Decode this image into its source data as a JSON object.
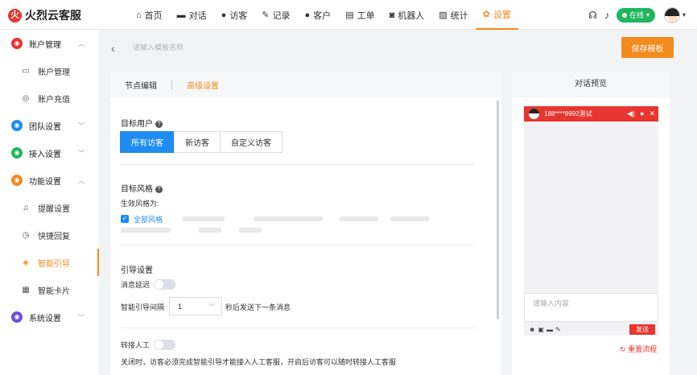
{
  "brand": {
    "logo_glyph": "火",
    "name": "火烈云客服",
    "color": "#e8352f"
  },
  "nav": [
    {
      "label": "首页",
      "icon": "home-icon",
      "glyph": "⌂"
    },
    {
      "label": "对话",
      "icon": "chat-icon",
      "glyph": "▬"
    },
    {
      "label": "访客",
      "icon": "visitors-icon",
      "glyph": "●"
    },
    {
      "label": "记录",
      "icon": "records-icon",
      "glyph": "✎"
    },
    {
      "label": "客户",
      "icon": "customer-icon",
      "glyph": "●"
    },
    {
      "label": "工单",
      "icon": "ticket-icon",
      "glyph": "▤"
    },
    {
      "label": "机器人",
      "icon": "robot-icon",
      "glyph": "◙"
    },
    {
      "label": "统计",
      "icon": "stats-icon",
      "glyph": "▨"
    },
    {
      "label": "设置",
      "icon": "settings-icon",
      "glyph": "✿",
      "active": true
    }
  ],
  "toolbar": {
    "headset_glyph": "☊",
    "bell_glyph": "♪",
    "status": "在线",
    "status_caret": "▾",
    "user_caret": "▾"
  },
  "sidebar": {
    "groups": [
      {
        "label": "账户管理",
        "icon": "account-icon",
        "glyph": "◉",
        "color": "#e8352f",
        "chevron": "︿",
        "items": [
          {
            "label": "账户管理",
            "icon": "card-icon",
            "glyph": "▭"
          },
          {
            "label": "账户充值",
            "icon": "recharge-icon",
            "glyph": "◎"
          }
        ]
      },
      {
        "label": "团队设置",
        "icon": "team-icon",
        "glyph": "◉",
        "color": "#1f8cf2",
        "chevron": "﹀",
        "items": []
      },
      {
        "label": "接入设置",
        "icon": "access-icon",
        "glyph": "◉",
        "color": "#1fb55c",
        "chevron": "﹀",
        "items": []
      },
      {
        "label": "功能设置",
        "icon": "feature-icon",
        "glyph": "◉",
        "color": "#f38a1d",
        "chevron": "︿",
        "items": [
          {
            "label": "提醒设置",
            "icon": "bell-icon",
            "glyph": "♫"
          },
          {
            "label": "快捷回复",
            "icon": "quick-reply-icon",
            "glyph": "◷"
          },
          {
            "label": "智能引导",
            "icon": "guide-icon",
            "glyph": "◈",
            "active": true
          },
          {
            "label": "智能卡片",
            "icon": "grid-card-icon",
            "glyph": "▦"
          }
        ]
      },
      {
        "label": "系统设置",
        "icon": "system-icon",
        "glyph": "◉",
        "color": "#6b4fd8",
        "chevron": "﹀",
        "items": []
      }
    ]
  },
  "header": {
    "back_glyph": "‹",
    "template_placeholder": "请输入模板名称",
    "save_label": "保存模板"
  },
  "editor": {
    "tabs": [
      {
        "label": "节点编辑"
      },
      {
        "label": "高级设置",
        "active": true
      }
    ],
    "target_users": {
      "title": "目标用户",
      "help": "?",
      "options": [
        "所有访客",
        "新访客",
        "自定义访客"
      ],
      "selected": "所有访客"
    },
    "target_style": {
      "title": "目标风格",
      "help": "?",
      "effective_label": "生效风格为:",
      "checkbox_glyph": "✓",
      "checked_label": "全部风格"
    },
    "guide": {
      "title": "引导设置",
      "delay_label": "消息延迟",
      "interval_label": "智能引导间隔",
      "interval_value": "1",
      "interval_caret": "﹀",
      "interval_suffix": "秒后发送下一条消息"
    },
    "transfer": {
      "label": "转接人工",
      "description": "关闭时，访客必须完成智能引导才能接入人工客服，开启后访客可以随时转接人工客服"
    }
  },
  "preview": {
    "title": "对话预览",
    "visitor": "188****8992测试",
    "head_glyphs": [
      "◀)",
      "●",
      "✕"
    ],
    "input_placeholder": "请输入内容",
    "bottom_glyphs": [
      "☻",
      "▣",
      "▬",
      "✎"
    ],
    "send_label": "发送",
    "reset_label": "重置流程",
    "reset_glyph": "↻"
  }
}
